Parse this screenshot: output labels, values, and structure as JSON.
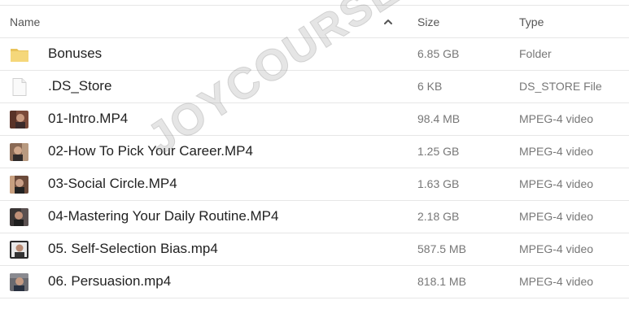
{
  "header": {
    "name_label": "Name",
    "size_label": "Size",
    "type_label": "Type",
    "sort_icon": "chevron-up-icon"
  },
  "files": [
    {
      "name": "Bonuses",
      "size": "6.85 GB",
      "type": "Folder",
      "icon": "folder-icon"
    },
    {
      "name": ".DS_Store",
      "size": "6 KB",
      "type": "DS_STORE File",
      "icon": "file-icon"
    },
    {
      "name": "01-Intro.MP4",
      "size": "98.4 MB",
      "type": "MPEG-4 video",
      "icon": "video-thumbnail-icon"
    },
    {
      "name": "02-How To Pick Your Career.MP4",
      "size": "1.25 GB",
      "type": "MPEG-4 video",
      "icon": "video-thumbnail-icon"
    },
    {
      "name": "03-Social Circle.MP4",
      "size": "1.63 GB",
      "type": "MPEG-4 video",
      "icon": "video-thumbnail-icon"
    },
    {
      "name": "04-Mastering Your Daily Routine.MP4",
      "size": "2.18 GB",
      "type": "MPEG-4 video",
      "icon": "video-thumbnail-icon"
    },
    {
      "name": "05. Self-Selection Bias.mp4",
      "size": "587.5 MB",
      "type": "MPEG-4 video",
      "icon": "video-thumbnail-icon"
    },
    {
      "name": "06. Persuasion.mp4",
      "size": "818.1 MB",
      "type": "MPEG-4 video",
      "icon": "video-thumbnail-icon"
    }
  ],
  "watermark": "JOYCOURSES.COM",
  "colors": {
    "folder": "#f5d77a",
    "folder_tab": "#e9c35a",
    "divider": "#e6e6e6",
    "muted_text": "#777777"
  }
}
